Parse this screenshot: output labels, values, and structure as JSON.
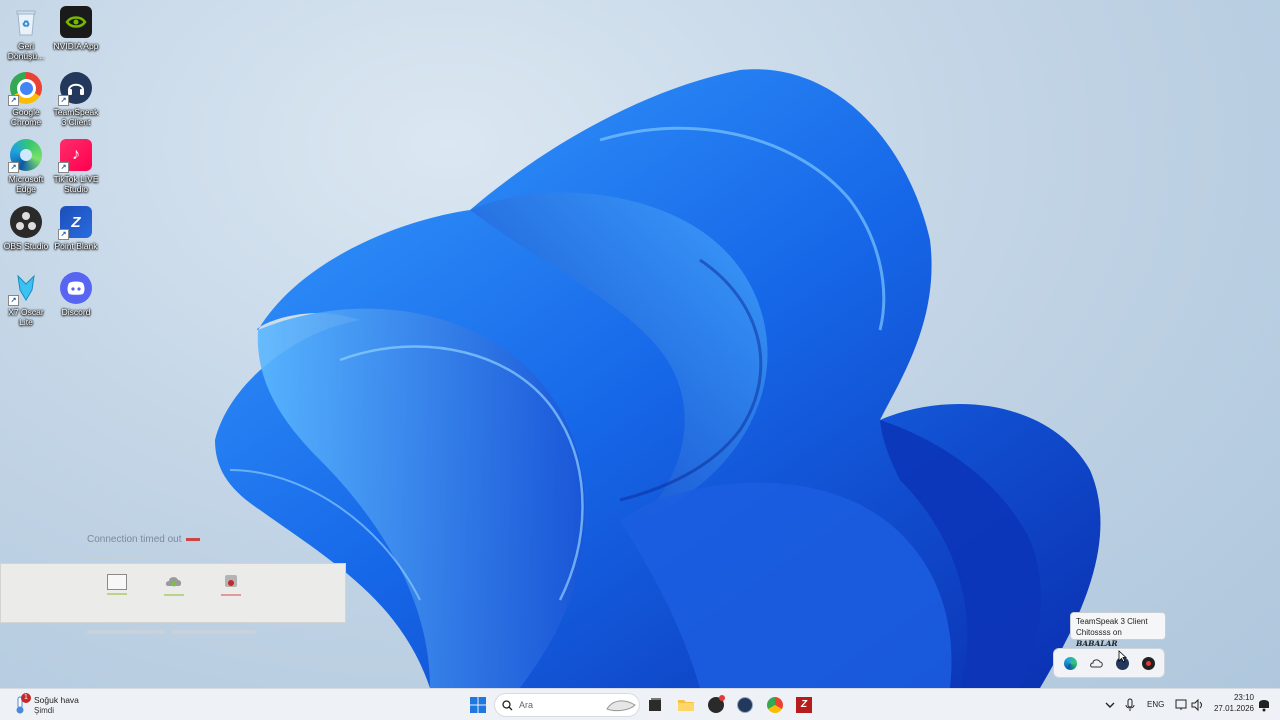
{
  "desktop": {
    "icons": [
      {
        "label": "Geri Dönüşü...",
        "icon": "recycle-bin-icon"
      },
      {
        "label": "NVIDIA App",
        "icon": "nvidia-icon"
      },
      {
        "label": "Google Chrome",
        "icon": "chrome-icon"
      },
      {
        "label": "TeamSpeak 3 Client",
        "icon": "teamspeak-icon"
      },
      {
        "label": "Microsoft Edge",
        "icon": "edge-icon"
      },
      {
        "label": "TikTok LIVE Studio",
        "icon": "tiktok-icon"
      },
      {
        "label": "OBS Studio",
        "icon": "obs-icon"
      },
      {
        "label": "Point Blank",
        "icon": "pointblank-icon"
      },
      {
        "label": "X7 Oscar Lite",
        "icon": "x7-icon"
      },
      {
        "label": "Discord",
        "icon": "discord-icon"
      }
    ]
  },
  "connection_error": {
    "title": "Connection timed out"
  },
  "tooltip": {
    "app": "TeamSpeak 3 Client",
    "user": "Chitossss on",
    "server": "BABALAR"
  },
  "taskbar": {
    "weather_title": "Soğuk hava",
    "weather_sub": "Şimdi",
    "weather_badge": "1",
    "search_placeholder": "Ara",
    "language": "ENG",
    "time": "23:10",
    "date": "27.01.2026"
  },
  "colors": {
    "accent": "#1e6fe0",
    "taskbar_bg": "#eef1f5"
  }
}
